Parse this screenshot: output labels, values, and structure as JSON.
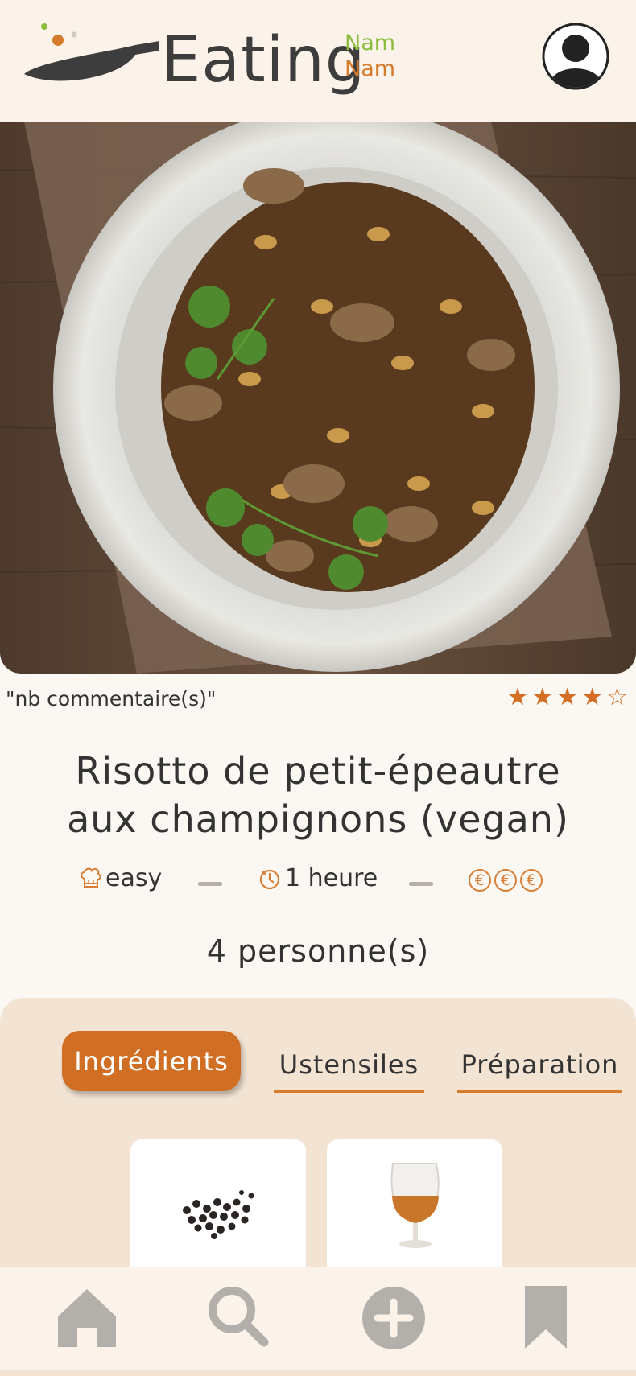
{
  "header": {
    "logo_word": "Eating",
    "logo_nam_top": "Nam",
    "logo_nam_bottom": "Nam",
    "avatar_icon": "user-circle-icon"
  },
  "recipe": {
    "comments_label": "\"nb commentaire(s)\"",
    "rating": 4,
    "rating_max": 5,
    "title_line1": "Risotto de petit-épeautre",
    "title_line2": "aux champignons (vegan)",
    "difficulty": "easy",
    "duration": "1 heure",
    "price_symbol": "€",
    "price_level": 3,
    "servings": "4 personne(s)"
  },
  "tabs": [
    {
      "label": "Ingrédients",
      "active": true
    },
    {
      "label": "Ustensiles",
      "active": false
    },
    {
      "label": "Préparation",
      "active": false
    }
  ],
  "ingredients": [
    {
      "icon": "black-pepper-image"
    },
    {
      "icon": "cognac-glass-image"
    }
  ],
  "navbar": {
    "items": [
      "home-icon",
      "search-icon",
      "add-icon",
      "bookmark-icon"
    ]
  },
  "colors": {
    "accent": "#d06f24",
    "green": "#8dbd3f",
    "panel": "#f2e3d3",
    "nav_icon": "#b3b0ac"
  }
}
